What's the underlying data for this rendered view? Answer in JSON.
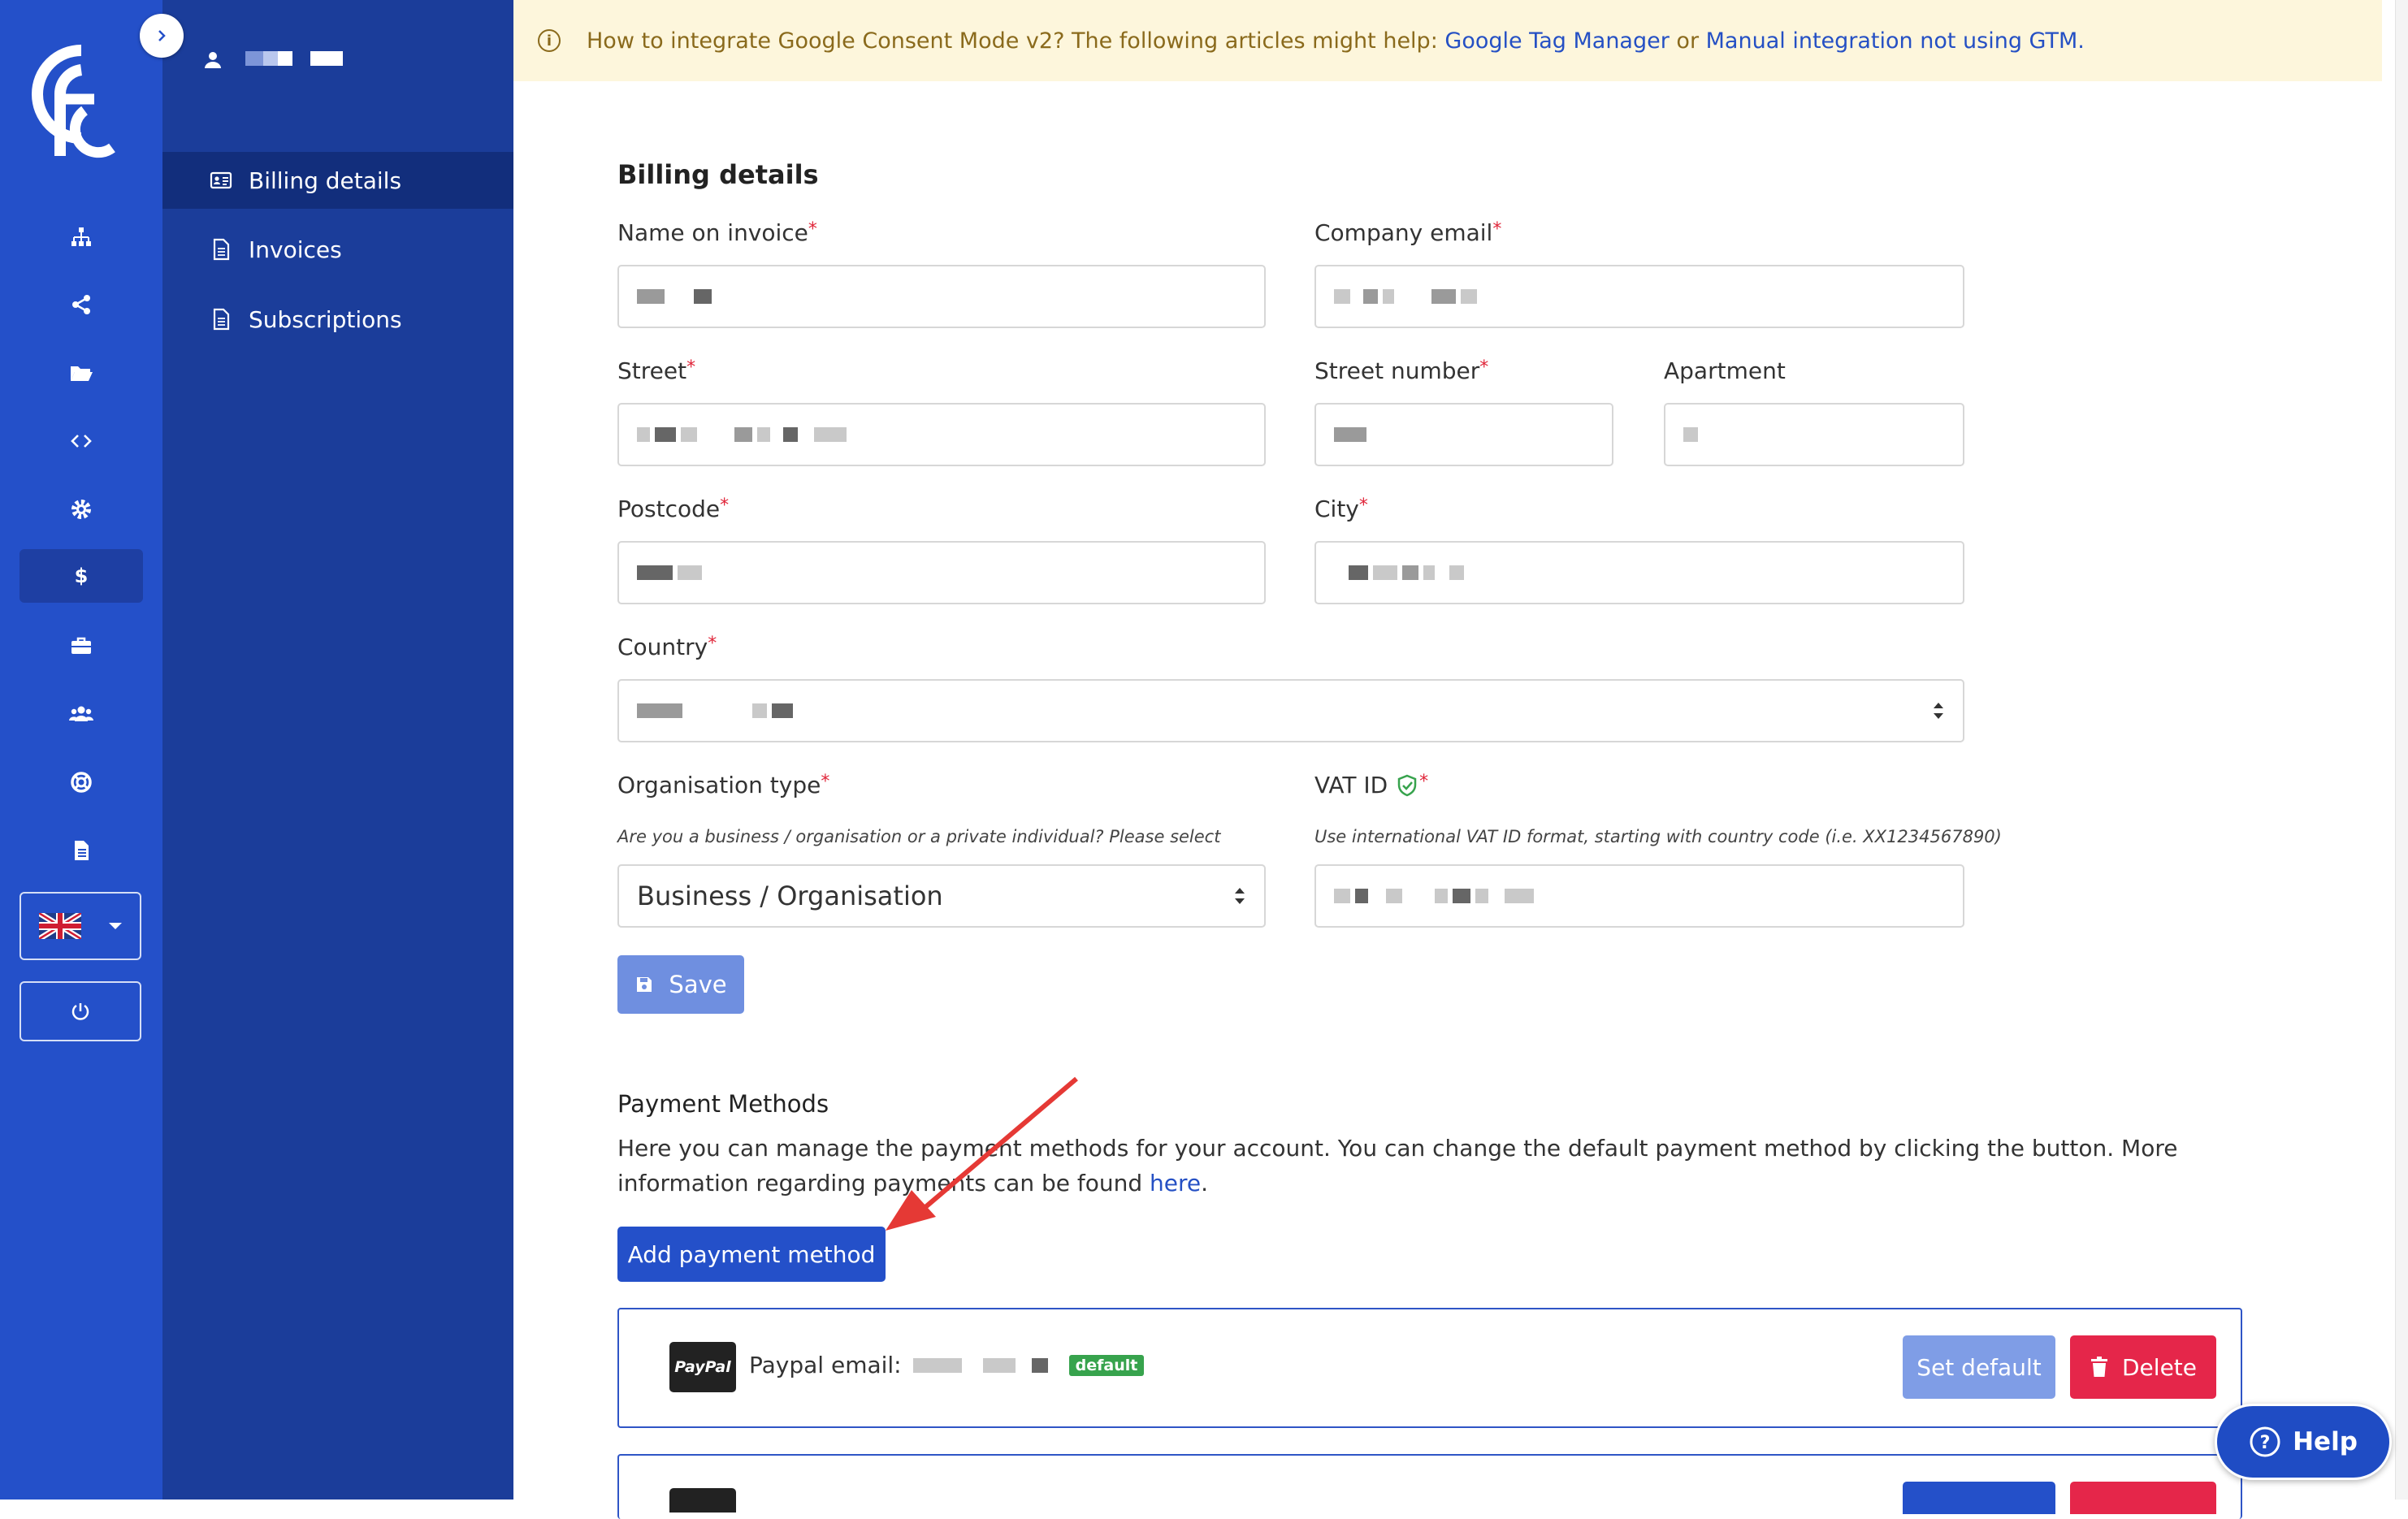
{
  "notice": {
    "text": "How to integrate Google Consent Mode v2? The following articles might help:",
    "link_gtm": "Google Tag Manager",
    "or": "or",
    "link_manual": "Manual integration not using GTM."
  },
  "sidebar": {
    "items": [
      {
        "label": "Billing details",
        "icon": "id-card-icon",
        "active": true
      },
      {
        "label": "Invoices",
        "icon": "document-icon",
        "active": false
      },
      {
        "label": "Subscriptions",
        "icon": "document-icon",
        "active": false
      }
    ]
  },
  "rail": {
    "icons": [
      "sitemap-icon",
      "share-icon",
      "folder-open-icon",
      "code-icon",
      "gear-icon",
      "dollar-icon",
      "briefcase-icon",
      "users-icon",
      "lifebuoy-icon",
      "file-text-icon"
    ],
    "active": "dollar-icon",
    "language_flag": "uk-flag-icon"
  },
  "billing": {
    "title": "Billing details",
    "name_on_invoice": "Name on invoice",
    "company_email": "Company email",
    "street": "Street",
    "street_number": "Street number",
    "apartment": "Apartment",
    "postcode": "Postcode",
    "city": "City",
    "country": "Country",
    "organisation_type": "Organisation type",
    "organisation_hint": "Are you a business / organisation or a private individual? Please select",
    "organisation_value": "Business / Organisation",
    "vat_id": "VAT ID",
    "vat_hint": "Use international VAT ID format, starting with country code (i.e. XX1234567890)",
    "required_mark": "*",
    "save_label": "Save"
  },
  "payment": {
    "title": "Payment Methods",
    "description": "Here you can manage the payment methods for your account. You can change the default payment method by clicking the button. More information regarding payments can be found",
    "here_link": "here",
    "period": ".",
    "add_label": "Add payment method",
    "methods": [
      {
        "logo": "PayPal",
        "label": "Paypal email:",
        "badge": "default",
        "set_default": "Set default",
        "delete": "Delete"
      }
    ]
  },
  "help_label": "Help",
  "colors": {
    "rail": "#2450c9",
    "sidebar": "#1b3d9a",
    "primary": "#2450c9",
    "danger": "#e5264a",
    "success": "#37a34d",
    "notice_bg": "#fdf6dc"
  }
}
